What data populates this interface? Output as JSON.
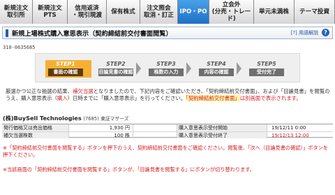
{
  "nav": {
    "tabs": [
      {
        "label": "新規注文\n取引所",
        "active": false
      },
      {
        "label": "新規注文\nPTS",
        "active": false
      },
      {
        "label": "信用返済\n・現引現渡",
        "active": false
      },
      {
        "label": "保有株式",
        "active": false
      },
      {
        "label": "注文照会\n取消・訂正",
        "active": false
      },
      {
        "label": "IPO・PO",
        "active": true
      },
      {
        "label": "立会外\n(分売・トレード)",
        "active": false
      },
      {
        "label": "単元未満株",
        "active": false
      },
      {
        "label": "テーマ投資",
        "active": false
      }
    ]
  },
  "page": {
    "title": "新規上場株式購入意思表示（契約締結前交付書面閲覧）",
    "help_link": "[?] 用語解説",
    "help_icon": "?",
    "code": "310-0635685"
  },
  "steps": [
    {
      "head": "STEP1",
      "label": "書面の確認",
      "active": true
    },
    {
      "head": "STEP2",
      "label": "目論見書の確認",
      "active": false
    },
    {
      "head": "STEP3",
      "label": "株数の入力",
      "active": false
    },
    {
      "head": "STEP4",
      "label": "内容の確認",
      "active": false
    },
    {
      "head": "STEP5",
      "label": "受付完了",
      "active": false
    }
  ],
  "notice": {
    "part1": "厳選かつ公正な抽選の結果、",
    "highlight": "補欠当選",
    "part2": "となりましたので、下記内容をご確認いただき、「契約締結前交付書面」、および「目論見書」を閲覧のうえ、購入意思表示（",
    "red1": "購入",
    "part3": "）日時までに「購入意思表示」を行ってください。",
    "mark": "「契約締結前交付書面」",
    "part4": "は別画面で表示されます。"
  },
  "stock": {
    "name": "(株)BuySell Technologies",
    "code_market": "(7685) 東証マザーズ"
  },
  "info": {
    "rows": [
      {
        "label": "発行価格又は売出価格",
        "value": "1,930 円",
        "label2": "購入意思表示受付開始",
        "value2": "19/12/11  0:00"
      },
      {
        "label": "補欠当選株数",
        "value": "100 株",
        "label2": "購入意思表示受付終了",
        "value2": "19/12/13  12:00"
      }
    ]
  },
  "notes": [
    "※「契約締結前交付書面を閲覧する」ボタンを押下のうえ、契約締結前交付書面をご確認ください。閲覧後、「次へ（目論見書の確認）」ボタンを押下ください。",
    "※当該画面の「契約締結前交付書面を閲覧する」ボタンが、「目論見書を閲覧する」にボタンが切り替わります。"
  ],
  "colors": {
    "accent_blue": "#1f6fc4",
    "step_active": "#f5b034",
    "step_inactive": "#6f6f6f",
    "alert_red": "#d41f24"
  }
}
